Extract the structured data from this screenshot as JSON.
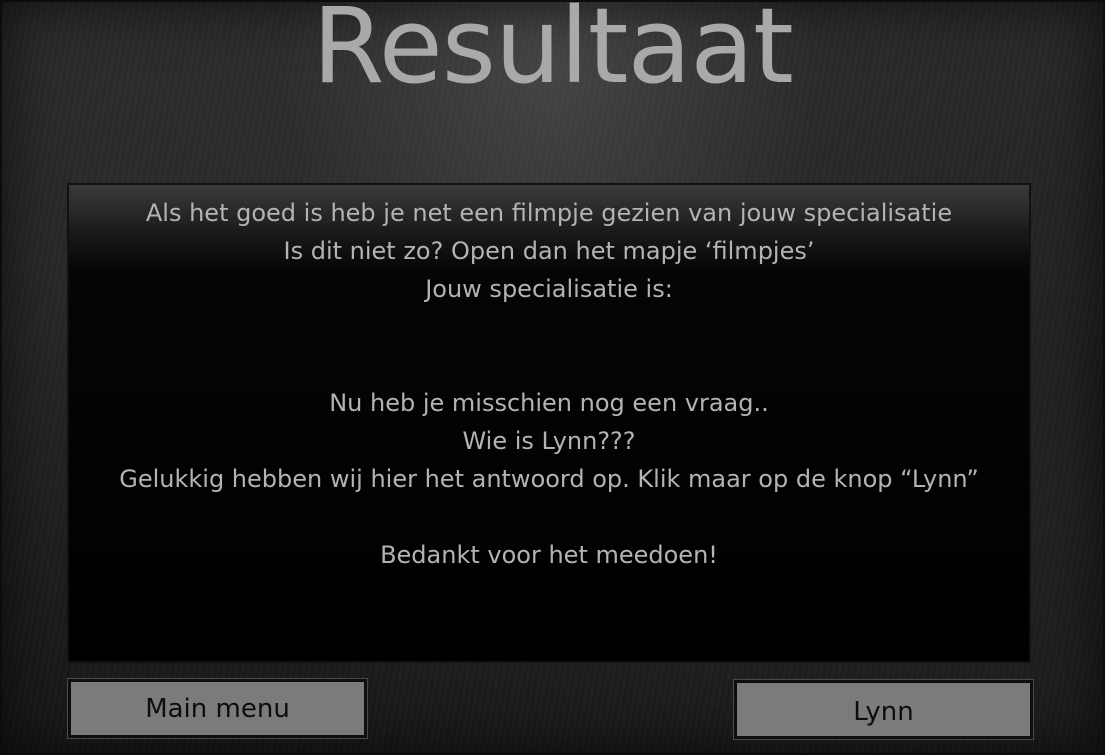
{
  "page": {
    "title": "Resultaat"
  },
  "panel": {
    "line1": "Als het goed is heb je net een filmpje gezien van jouw specialisatie",
    "line2": "Is dit niet zo? Open dan het mapje ‘filmpjes’",
    "line3": "Jouw specialisatie is:",
    "line4": "Nu heb je misschien nog een vraag..",
    "line5": "Wie is Lynn???",
    "line6": "Gelukkig hebben wij hier het antwoord op. Klik maar op de knop “Lynn”",
    "line7": "Bedankt voor het meedoen!"
  },
  "buttons": {
    "main_menu": "Main menu",
    "lynn": "Lynn"
  },
  "colors": {
    "background": "#1e1e1e",
    "title": "#a9a9a9",
    "panel": "#000000",
    "panel_text": "#b3b3b3",
    "button_fill": "#7b7b7b",
    "button_text": "#0d0d0d"
  }
}
